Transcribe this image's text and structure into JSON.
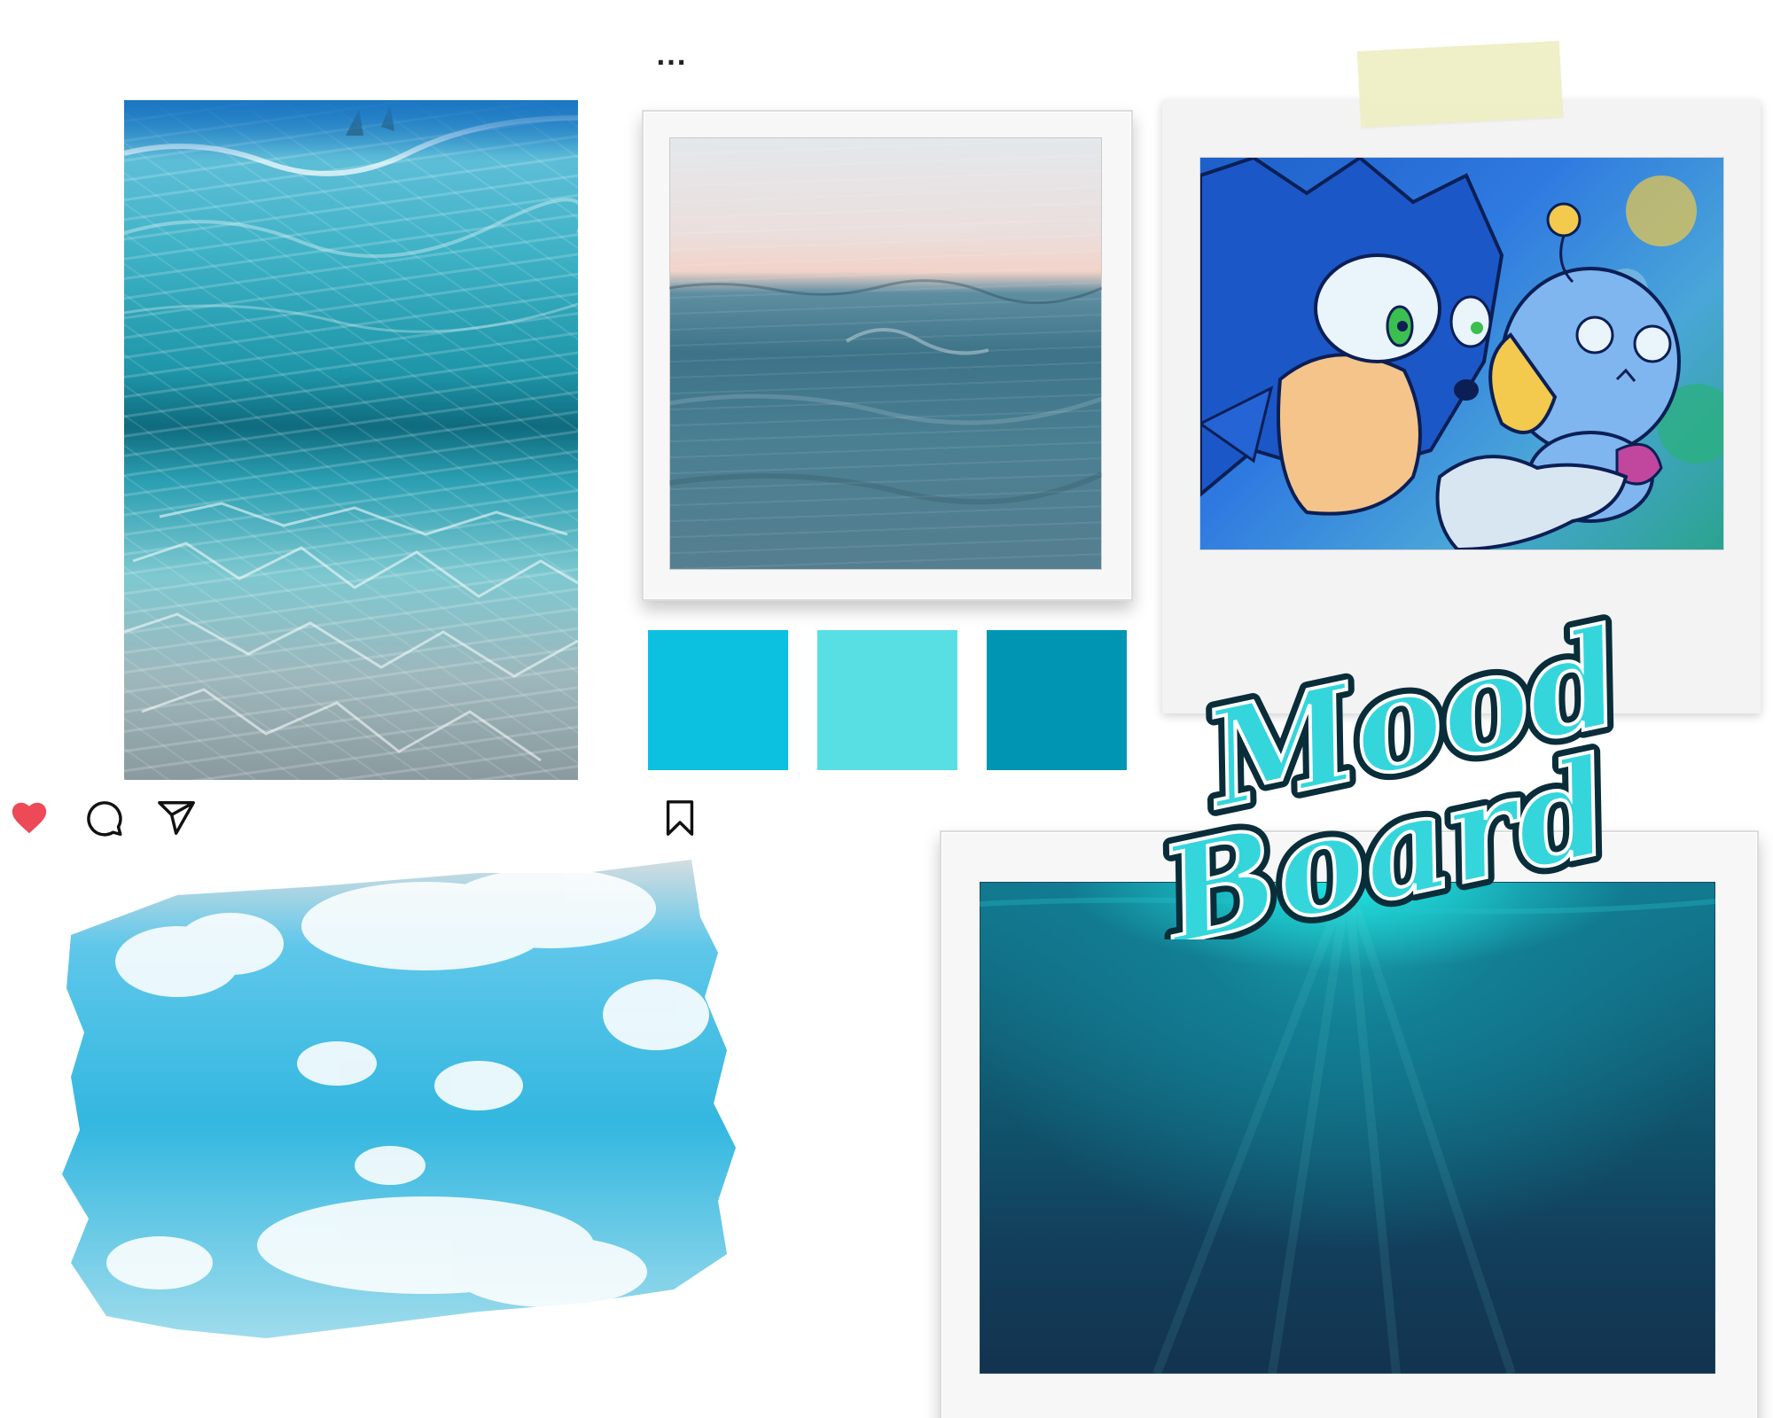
{
  "post": {
    "more_label": "...",
    "icons": {
      "like": "heart-icon",
      "comment": "comment-icon",
      "share": "share-icon",
      "save": "bookmark-icon"
    },
    "like_color": "#ed4956"
  },
  "palette": {
    "swatches": [
      {
        "name": "cyan",
        "color": "#0bc1df"
      },
      {
        "name": "aqua",
        "color": "#58dfe4"
      },
      {
        "name": "teal",
        "color": "#0096b3"
      }
    ]
  },
  "title": {
    "line1": "Mood",
    "line2": "Board",
    "fill_color": "#34d6dc",
    "outline_color": "#0a2d3a"
  }
}
